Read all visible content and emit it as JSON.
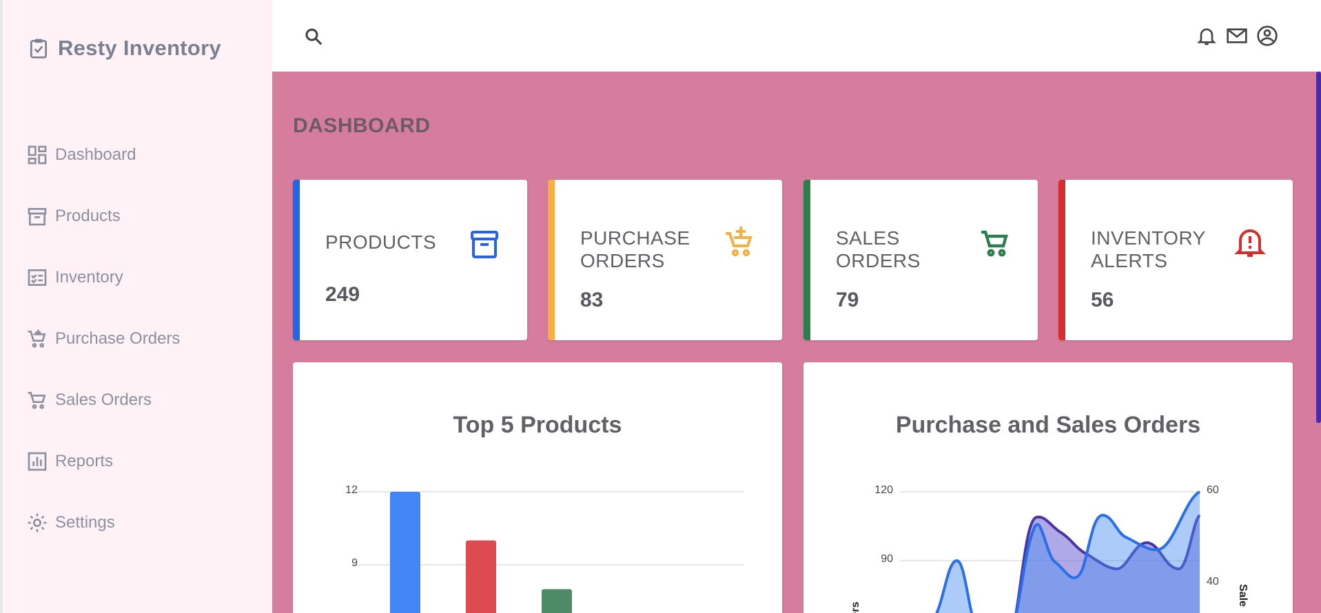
{
  "app": {
    "title": "Resty Inventory"
  },
  "sidebar": {
    "items": [
      {
        "label": "Dashboard",
        "icon": "dashboard-icon"
      },
      {
        "label": "Products",
        "icon": "archive-icon"
      },
      {
        "label": "Inventory",
        "icon": "inventory-checklist-icon"
      },
      {
        "label": "Purchase Orders",
        "icon": "cart-plus-icon"
      },
      {
        "label": "Sales Orders",
        "icon": "cart-icon"
      },
      {
        "label": "Reports",
        "icon": "bar-chart-icon"
      },
      {
        "label": "Settings",
        "icon": "gear-icon"
      }
    ]
  },
  "topbar": {
    "icons": [
      "search-icon",
      "bell-icon",
      "mail-icon",
      "account-circle-icon"
    ]
  },
  "page": {
    "title": "DASHBOARD"
  },
  "colors": {
    "blue": "#2563eb",
    "yellow": "#f5b041",
    "green": "#2e7d4f",
    "red": "#d32f2f",
    "main_bg": "#d67d9e",
    "sidebar_bg": "#fff2f7"
  },
  "cards": [
    {
      "label": "PRODUCTS",
      "value": "249",
      "color": "#2563eb",
      "icon": "archive-icon"
    },
    {
      "label": "PURCHASE ORDERS",
      "value": "83",
      "color": "#f5b041",
      "icon": "cart-plus-icon"
    },
    {
      "label": "SALES ORDERS",
      "value": "79",
      "color": "#2e7d4f",
      "icon": "cart-icon"
    },
    {
      "label": "INVENTORY ALERTS",
      "value": "56",
      "color": "#d32f2f",
      "icon": "bell-alert-icon"
    }
  ],
  "chart_data": [
    {
      "type": "bar",
      "title": "Top 5 Products",
      "y_ticks": [
        "12",
        "9"
      ],
      "values": [
        12,
        10,
        8
      ],
      "colors": [
        "#4285f4",
        "#db4b4f",
        "#4f8a66"
      ]
    },
    {
      "type": "area",
      "title": "Purchase and Sales Orders",
      "y_left_ticks": [
        "120",
        "90"
      ],
      "y_right_ticks": [
        "60",
        "40"
      ],
      "y_left_label": "Orders",
      "y_right_label": "Sale"
    }
  ]
}
